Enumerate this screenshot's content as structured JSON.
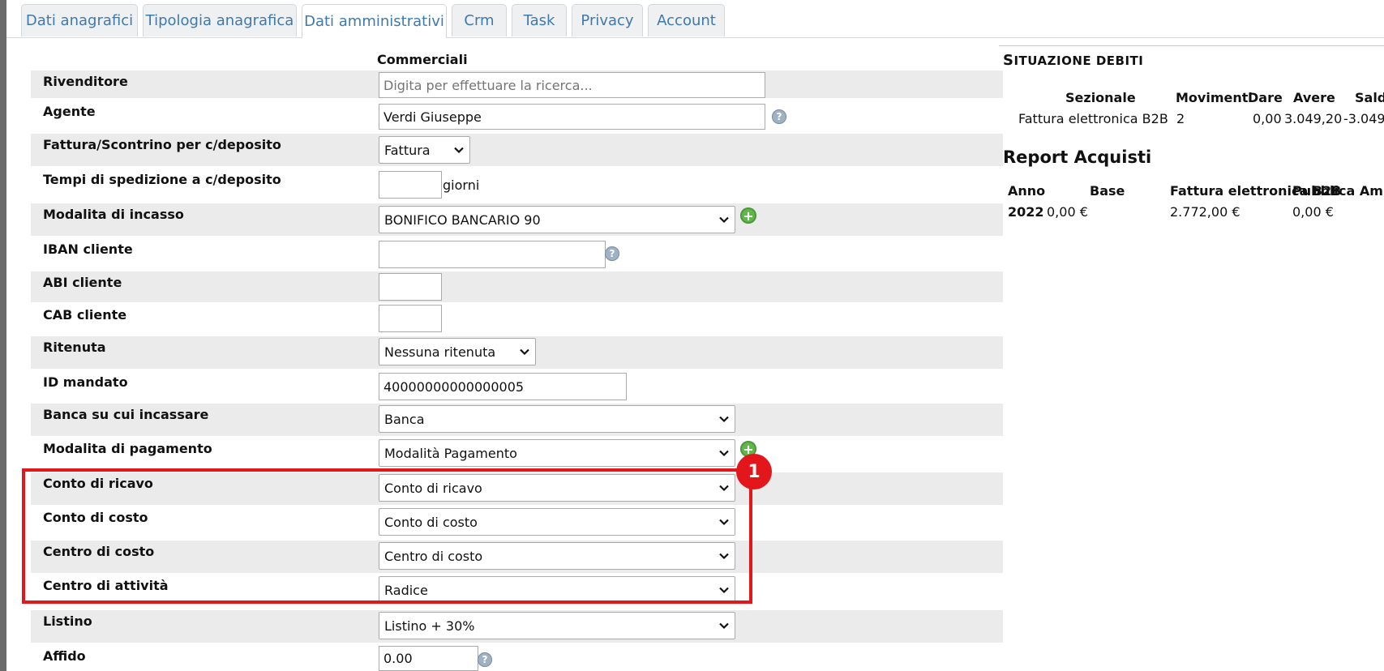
{
  "tabs": [
    {
      "label": "Dati anagrafici"
    },
    {
      "label": "Tipologia anagrafica"
    },
    {
      "label": "Dati amministrativi"
    },
    {
      "label": "Crm"
    },
    {
      "label": "Task"
    },
    {
      "label": "Privacy"
    },
    {
      "label": "Account"
    }
  ],
  "section_title": "Commerciali",
  "fields": {
    "rivenditore": {
      "label": "Rivenditore",
      "placeholder": "Digita per effettuare la ricerca..."
    },
    "agente": {
      "label": "Agente",
      "value": "Verdi Giuseppe"
    },
    "fattura": {
      "label": "Fattura/Scontrino per c/deposito",
      "value": "Fattura"
    },
    "tempi": {
      "label": "Tempi di spedizione a c/deposito",
      "value": "",
      "suffix": "giorni"
    },
    "incasso": {
      "label": "Modalita di incasso",
      "value": "BONIFICO BANCARIO 90"
    },
    "iban": {
      "label": "IBAN cliente",
      "value": ""
    },
    "abi": {
      "label": "ABI cliente",
      "value": ""
    },
    "cab": {
      "label": "CAB cliente",
      "value": ""
    },
    "ritenuta": {
      "label": "Ritenuta",
      "value": "Nessuna ritenuta"
    },
    "mandato": {
      "label": "ID mandato",
      "value": "40000000000000005"
    },
    "banca": {
      "label": "Banca su cui incassare",
      "value": "Banca"
    },
    "pagamento": {
      "label": "Modalita di pagamento",
      "value": "Modalità Pagamento"
    },
    "ricavo": {
      "label": "Conto di ricavo",
      "value": "Conto di ricavo"
    },
    "costo": {
      "label": "Conto di costo",
      "value": "Conto di costo"
    },
    "centro_costo": {
      "label": "Centro di costo",
      "value": "Centro di costo"
    },
    "centro_attivita": {
      "label": "Centro di attività",
      "value": "Radice"
    },
    "listino": {
      "label": "Listino",
      "value": "Listino + 30%"
    },
    "affido": {
      "label": "Affido",
      "value": "0.00"
    }
  },
  "help_glyph": "?",
  "plus_glyph": "+",
  "badge": "1",
  "debiti": {
    "title_first": "S",
    "title_rest": "ITUAZIONE DEBITI",
    "headers": {
      "sezionale": "Sezionale",
      "movimenti": "Movimenti",
      "dare": "Dare",
      "avere": "Avere",
      "saldo": "Sald"
    },
    "row": {
      "sezionale": "Fattura elettronica B2B",
      "movimenti": "2",
      "dare": "0,00",
      "avere": "3.049,20",
      "saldo": "-3.049"
    }
  },
  "report": {
    "title": "Report Acquisti",
    "headers": {
      "anno": "Anno",
      "base": "Base",
      "b2b": "Fattura elettronica B2B",
      "pa": "Pubblica Amm"
    },
    "row": {
      "anno": "2022",
      "base": "0,00 €",
      "b2b": "2.772,00 €",
      "pa": "0,00 €"
    }
  },
  "colors": {
    "accent": "#3f79ad",
    "highlight": "#e3161b",
    "row_gray": "#ebebeb"
  }
}
